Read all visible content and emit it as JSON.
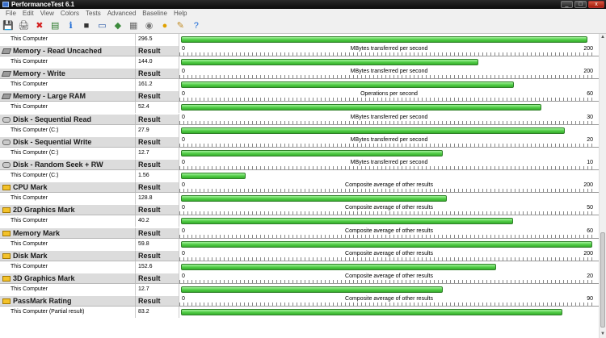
{
  "window": {
    "title": "PerformanceTest 6.1",
    "controls": [
      "_",
      "□",
      "x"
    ]
  },
  "menu": [
    "File",
    "Edit",
    "View",
    "Colors",
    "Tests",
    "Advanced",
    "Baseline",
    "Help"
  ],
  "toolbar_icons": [
    {
      "name": "save-icon",
      "glyph": "💾",
      "color": "#1f4fa6"
    },
    {
      "name": "print-icon",
      "glyph": "🖨",
      "color": "#555555"
    },
    {
      "name": "delete-icon",
      "glyph": "✖",
      "color": "#d42020"
    },
    {
      "name": "export-icon",
      "glyph": "▤",
      "color": "#2b7a2b"
    },
    {
      "name": "info-icon",
      "glyph": "ℹ",
      "color": "#1d6bd6"
    },
    {
      "name": "cpu-icon",
      "glyph": "■",
      "color": "#333333"
    },
    {
      "name": "monitor-icon",
      "glyph": "▭",
      "color": "#2a5aa8"
    },
    {
      "name": "graphics-icon",
      "glyph": "◆",
      "color": "#3c8a3c"
    },
    {
      "name": "memory-icon",
      "glyph": "▦",
      "color": "#6a6a6a"
    },
    {
      "name": "disk-icon",
      "glyph": "◉",
      "color": "#777777"
    },
    {
      "name": "passmark-icon",
      "glyph": "●",
      "color": "#e0a100"
    },
    {
      "name": "results-icon",
      "glyph": "✎",
      "color": "#c08a20"
    },
    {
      "name": "help-icon",
      "glyph": "?",
      "color": "#1d6bd6"
    }
  ],
  "first_row": {
    "label": "This Computer",
    "value": "296.5",
    "fraction": 0.9834
  },
  "sections": [
    {
      "title": "Memory - Read Uncached",
      "icon": "mem",
      "result_header": "Result",
      "unit": "MBytes transferred per second",
      "min": "0",
      "max": "200",
      "row_label": "This Computer",
      "value": "144.0",
      "fraction": 0.72
    },
    {
      "title": "Memory - Write",
      "icon": "mem",
      "result_header": "Result",
      "unit": "MBytes transferred per second",
      "min": "0",
      "max": "200",
      "row_label": "This Computer",
      "value": "161.2",
      "fraction": 0.806
    },
    {
      "title": "Memory - Large RAM",
      "icon": "mem",
      "result_header": "Result",
      "unit": "Operations per second",
      "min": "0",
      "max": "60",
      "row_label": "This Computer",
      "value": "52.4",
      "fraction": 0.8733
    },
    {
      "title": "Disk - Sequential Read",
      "icon": "disk",
      "result_header": "Result",
      "unit": "MBytes transferred per second",
      "min": "0",
      "max": "30",
      "row_label": "This Computer (C:)",
      "value": "27.9",
      "fraction": 0.93
    },
    {
      "title": "Disk - Sequential Write",
      "icon": "disk",
      "result_header": "Result",
      "unit": "MBytes transferred per second",
      "min": "0",
      "max": "20",
      "row_label": "This Computer (C:)",
      "value": "12.7",
      "fraction": 0.635
    },
    {
      "title": "Disk - Random Seek + RW",
      "icon": "disk",
      "result_header": "Result",
      "unit": "MBytes transferred per second",
      "min": "0",
      "max": "10",
      "row_label": "This Computer (C:)",
      "value": "1.56",
      "fraction": 0.156
    },
    {
      "title": "CPU Mark",
      "icon": "mark",
      "result_header": "Result",
      "unit": "Composite average of other results",
      "min": "0",
      "max": "200",
      "row_label": "This Computer",
      "value": "128.8",
      "fraction": 0.644
    },
    {
      "title": "2D Graphics Mark",
      "icon": "mark",
      "result_header": "Result",
      "unit": "Composite average of other results",
      "min": "0",
      "max": "50",
      "row_label": "This Computer",
      "value": "40.2",
      "fraction": 0.804
    },
    {
      "title": "Memory Mark",
      "icon": "mark",
      "result_header": "Result",
      "unit": "Composite average of other results",
      "min": "0",
      "max": "60",
      "row_label": "This Computer",
      "value": "59.8",
      "fraction": 0.9967
    },
    {
      "title": "Disk Mark",
      "icon": "mark",
      "result_header": "Result",
      "unit": "Composite average of other results",
      "min": "0",
      "max": "200",
      "row_label": "This Computer",
      "value": "152.6",
      "fraction": 0.763
    },
    {
      "title": "3D Graphics Mark",
      "icon": "mark",
      "result_header": "Result",
      "unit": "Composite average of other results",
      "min": "0",
      "max": "20",
      "row_label": "This Computer",
      "value": "12.7",
      "fraction": 0.635
    },
    {
      "title": "PassMark Rating",
      "icon": "mark",
      "result_header": "Result",
      "unit": "Composite average of other results",
      "min": "0",
      "max": "90",
      "row_label": "This Computer (Partial result)",
      "value": "83.2",
      "fraction": 0.9244
    }
  ]
}
